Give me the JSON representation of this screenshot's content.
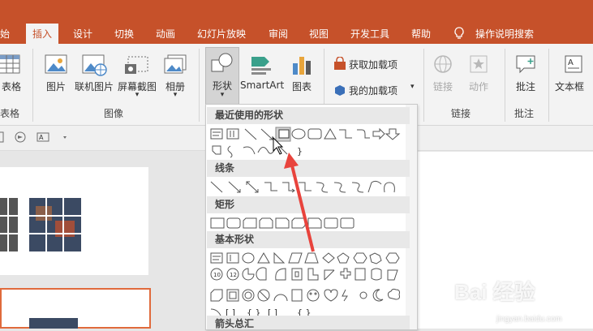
{
  "tabs": [
    {
      "label": "始",
      "active": false
    },
    {
      "label": "插入",
      "active": true
    },
    {
      "label": "设计",
      "active": false
    },
    {
      "label": "切换",
      "active": false
    },
    {
      "label": "动画",
      "active": false
    },
    {
      "label": "幻灯片放映",
      "active": false
    },
    {
      "label": "审阅",
      "active": false
    },
    {
      "label": "视图",
      "active": false
    },
    {
      "label": "开发工具",
      "active": false
    },
    {
      "label": "帮助",
      "active": false
    }
  ],
  "tell_me": "操作说明搜索",
  "ribbon": {
    "table": {
      "label": "表格",
      "group": "表格"
    },
    "image_group": {
      "picture": "图片",
      "online_picture": "联机图片",
      "screenshot": "屏幕截图",
      "album": "相册",
      "group": "图像"
    },
    "illustrations": {
      "shapes": "形状",
      "smartart": "SmartArt",
      "chart": "图表"
    },
    "addins": {
      "get": "获取加载项",
      "mine": "我的加载项"
    },
    "links": {
      "link": "链接",
      "action": "动作",
      "group": "链接"
    },
    "comments": {
      "comment": "批注",
      "group": "批注"
    },
    "text": {
      "textbox": "文本框"
    }
  },
  "dropdown": {
    "sections": {
      "recent": "最近使用的形状",
      "lines": "线条",
      "rect": "矩形",
      "basic": "基本形状",
      "arrows": "箭头总汇"
    }
  },
  "watermark": {
    "brand": "Bai 经验",
    "url": "jingyan.baidu.com"
  },
  "colors": {
    "accent": "#c6512a",
    "annotation_arrow": "#e8433c"
  }
}
